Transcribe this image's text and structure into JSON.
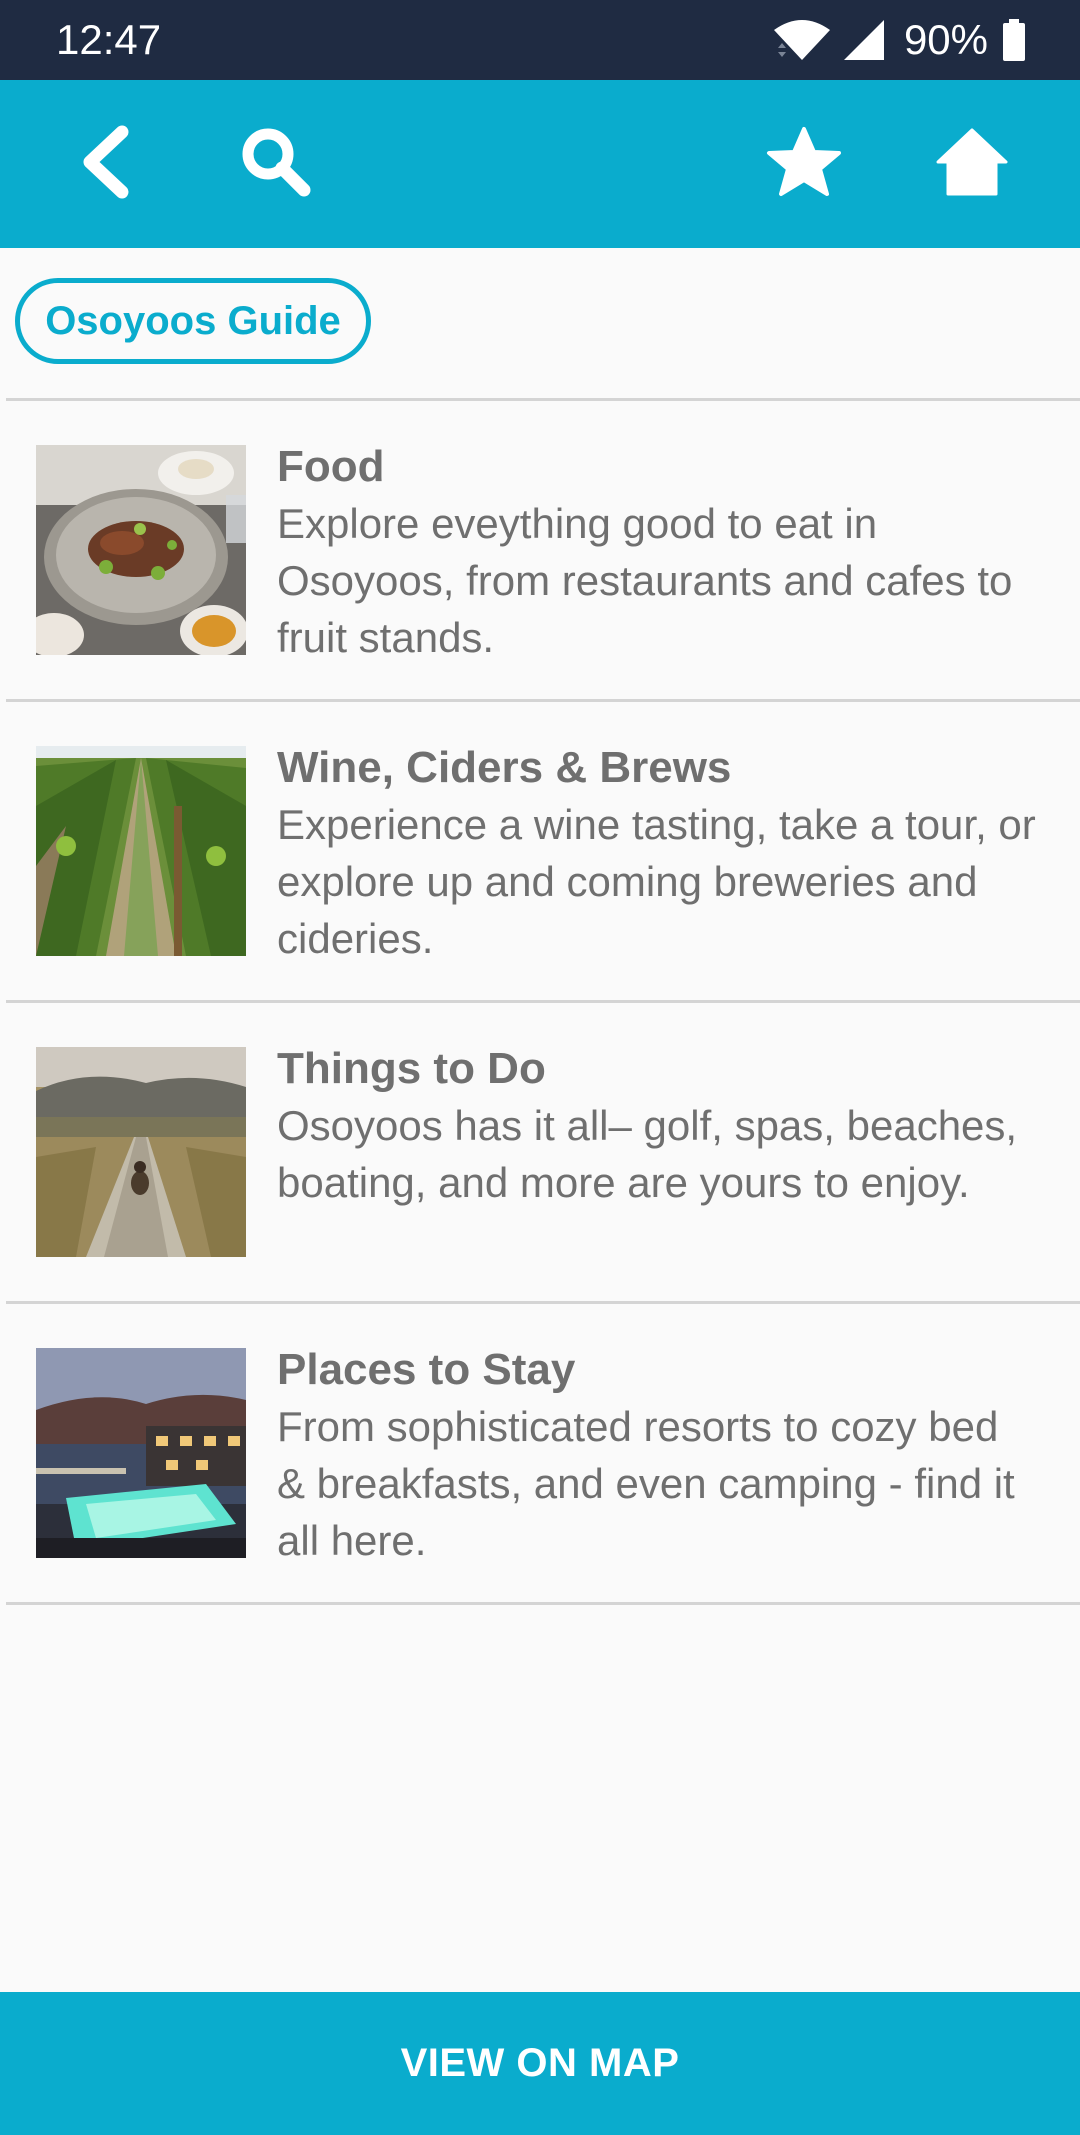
{
  "status_bar": {
    "time": "12:47",
    "battery": "90%",
    "icons": [
      "wifi-icon",
      "signal-icon",
      "battery-icon"
    ]
  },
  "toolbar": {
    "icons": [
      "back-icon",
      "search-icon",
      "star-icon",
      "home-icon"
    ]
  },
  "guide": {
    "title": "Osoyoos Guide"
  },
  "items": [
    {
      "title": "Food",
      "description": "Explore eveything good to eat in Osoyoos, from restaurants and cafes to fruit stands.",
      "image": "food-photo"
    },
    {
      "title": "Wine, Ciders & Brews",
      "description": "Experience a wine tasting, take a tour, or explore up and coming breweries and cideries.",
      "image": "vineyard-photo"
    },
    {
      "title": "Things to Do",
      "description": "Osoyoos has it all– golf, spas, beaches, boating, and more are yours to enjoy.",
      "image": "boardwalk-photo"
    },
    {
      "title": "Places to Stay",
      "description": "From sophisticated resorts to cozy bed & breakfasts, and even camping - find it all here.",
      "image": "resort-photo"
    }
  ],
  "footer": {
    "map_button_label": "VIEW ON MAP"
  },
  "colors": {
    "accent": "#0aaccd",
    "status_bar": "#1f2b42",
    "text": "#6f6f6f"
  }
}
